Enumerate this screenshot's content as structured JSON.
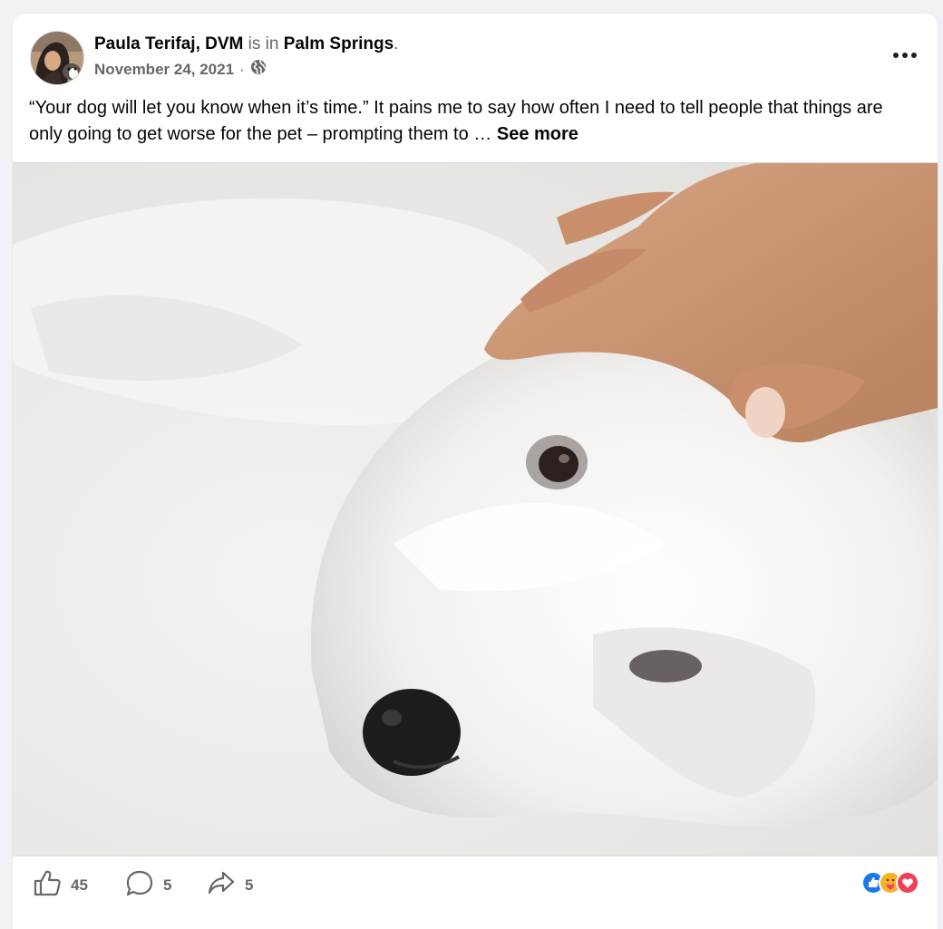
{
  "post": {
    "author": "Paula Terifaj, DVM",
    "location_connector": "is in",
    "location": "Palm Springs",
    "location_suffix": ".",
    "date": "November 24, 2021",
    "separator": "·",
    "audience_icon": "globe-icon",
    "more_icon": "more-dots-icon",
    "text": "“Your dog will let you know when it’s time.” It pains me to say how often I need to tell people that things are only going to get worse for the pet – prompting them to …",
    "see_more": "See more"
  },
  "actions": {
    "like": {
      "icon": "thumbs-up-icon",
      "count": "45"
    },
    "comment": {
      "icon": "comment-bubble-icon",
      "count": "5"
    },
    "share": {
      "icon": "share-arrow-icon",
      "count": "5"
    }
  },
  "reactions": [
    "like-reaction-icon",
    "care-reaction-icon",
    "love-reaction-icon"
  ],
  "colors": {
    "like_blue": "#1877f2",
    "love_red": "#f33e58",
    "care_yellow": "#f7b125",
    "muted_text": "#65676b"
  }
}
